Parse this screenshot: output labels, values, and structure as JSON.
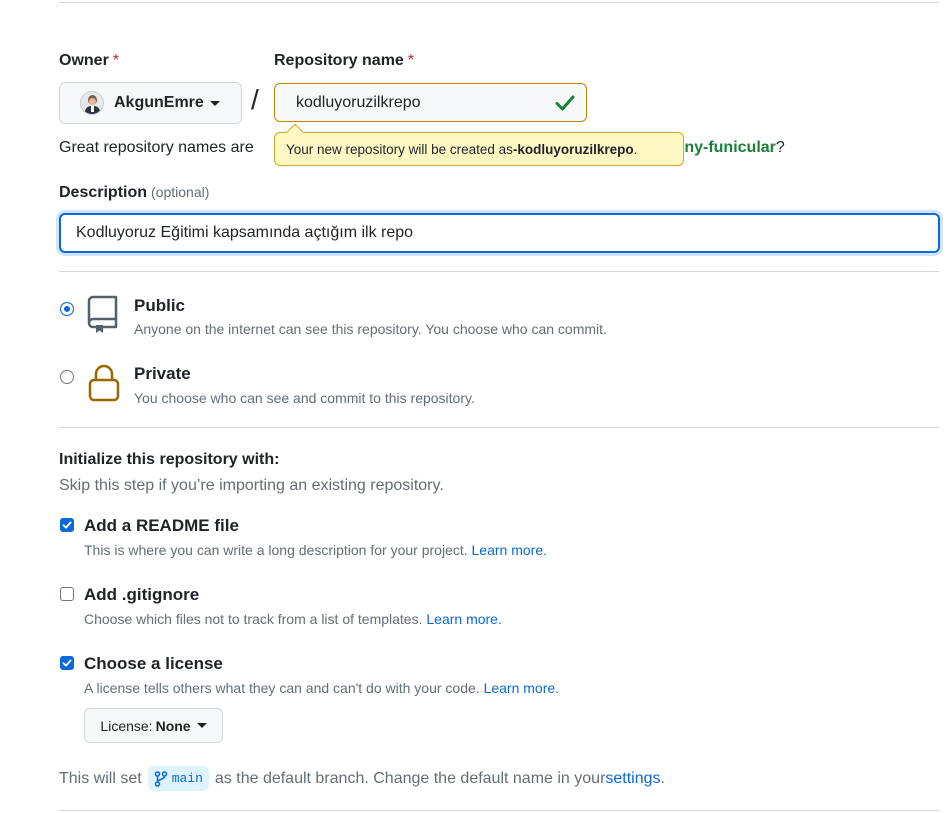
{
  "owner": {
    "label": "Owner",
    "required_mark": "*",
    "selected": "AkgunEmre"
  },
  "separator": "/",
  "repository": {
    "label": "Repository name",
    "required_mark": "*",
    "value": "kodluyoruzilkrepo"
  },
  "name_hint": {
    "prefix": "Great repository names are ",
    "suggestion": "shiny-funicular",
    "suffix": "?"
  },
  "tooltip": {
    "text_prefix": "Your new repository will be created as ",
    "name": "-kodluyoruzilkrepo",
    "text_suffix": "."
  },
  "description": {
    "label": "Description",
    "optional": "(optional)",
    "value": "Kodluyoruz Eğitimi kapsamında açtığım ilk repo"
  },
  "visibility": {
    "selected": "public",
    "options": [
      {
        "id": "public",
        "title": "Public",
        "desc": "Anyone on the internet can see this repository. You choose who can commit."
      },
      {
        "id": "private",
        "title": "Private",
        "desc": "You choose who can see and commit to this repository."
      }
    ]
  },
  "initialize": {
    "title": "Initialize this repository with:",
    "subtitle": "Skip this step if you’re importing an existing repository.",
    "options": [
      {
        "title": "Add a README file",
        "desc": "This is where you can write a long description for your project. ",
        "link": "Learn more.",
        "checked": true
      },
      {
        "title": "Add .gitignore",
        "desc": "Choose which files not to track from a list of templates. ",
        "link": "Learn more.",
        "checked": false
      },
      {
        "title": "Choose a license",
        "desc": "A license tells others what they can and can't do with your code. ",
        "link": "Learn more.",
        "checked": true
      }
    ]
  },
  "license": {
    "label": "License:",
    "value": "None"
  },
  "branch": {
    "prefix": "This will set ",
    "name": "main",
    "middle": " as the default branch. Change the default name in your ",
    "link": "settings",
    "suffix": "."
  },
  "colors": {
    "accent": "#0969da",
    "success": "#1a7f37",
    "warning_border": "#bf8700",
    "tooltip_bg": "#fff8c5",
    "private_icon": "#9a6700",
    "required": "#cf222e"
  },
  "icons": {
    "valid": "check-icon",
    "public": "repo-icon",
    "private": "lock-icon",
    "branch": "git-branch-icon"
  }
}
